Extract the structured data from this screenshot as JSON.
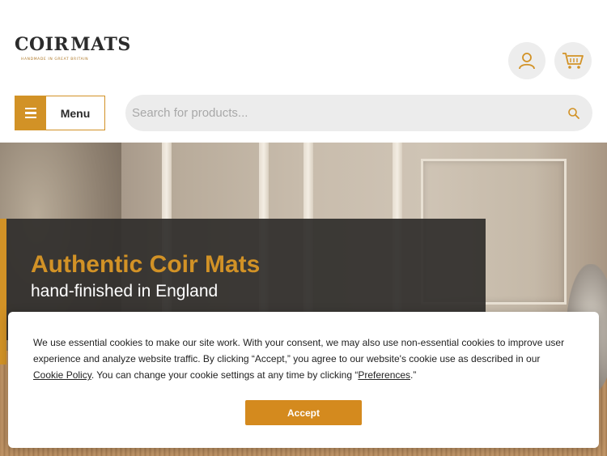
{
  "header": {
    "logo_text_left": "COIR",
    "logo_text_right": "MATS",
    "logo_tagline": "HANDMADE IN GREAT BRITAIN",
    "account_icon": "user-icon",
    "cart_icon": "basket-icon"
  },
  "nav": {
    "menu_label": "Menu",
    "menu_icon": "hamburger-icon"
  },
  "search": {
    "placeholder": "Search for products...",
    "value": "",
    "icon": "search-icon"
  },
  "hero": {
    "title": "Authentic Coir Mats",
    "subtitle": "hand-finished in England"
  },
  "cookie": {
    "text_part1": "We use essential cookies to make our site work. With your consent, we may also use non-essential cookies to improve user experience and analyze website traffic. By clicking “Accept,” you agree to our website's cookie use as described in our ",
    "policy_link": "Cookie Policy",
    "text_part2": ". You can change your cookie settings at any time by clicking “",
    "preferences_link": "Preferences",
    "text_part3": ".”",
    "accept_label": "Accept"
  },
  "colors": {
    "accent": "#d29226",
    "banner_bg": "#302e2c",
    "button": "#d48a1e"
  }
}
